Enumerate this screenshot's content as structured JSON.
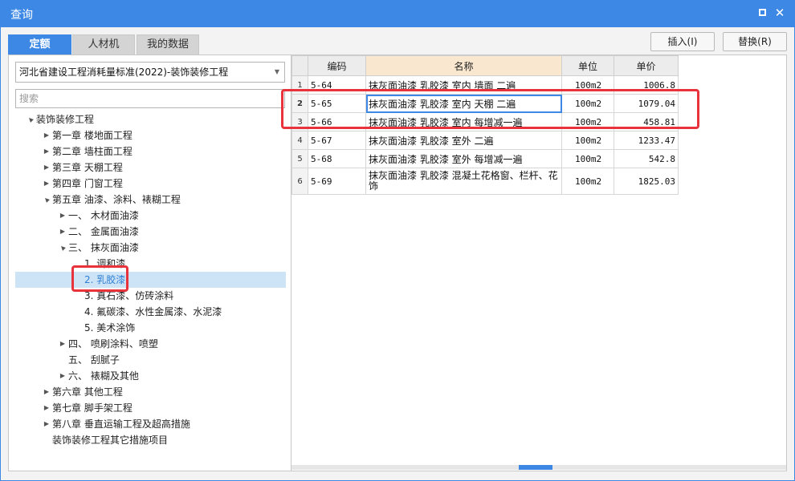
{
  "window": {
    "title": "查询"
  },
  "tabs": [
    {
      "label": "定额",
      "active": true
    },
    {
      "label": "人材机",
      "active": false
    },
    {
      "label": "我的数据",
      "active": false
    }
  ],
  "buttons": {
    "insert": "插入(I)",
    "replace": "替换(R)"
  },
  "library": {
    "selected": "河北省建设工程消耗量标准(2022)-装饰装修工程"
  },
  "search": {
    "placeholder": "搜索"
  },
  "tree": [
    {
      "label": "装饰装修工程",
      "level": 0,
      "toggle": "▲"
    },
    {
      "label": "第一章  楼地面工程",
      "level": 1,
      "toggle": "▶"
    },
    {
      "label": "第二章  墙柱面工程",
      "level": 1,
      "toggle": "▶"
    },
    {
      "label": "第三章  天棚工程",
      "level": 1,
      "toggle": "▶"
    },
    {
      "label": "第四章  门窗工程",
      "level": 1,
      "toggle": "▶"
    },
    {
      "label": "第五章  油漆、涂料、裱糊工程",
      "level": 1,
      "toggle": "▲"
    },
    {
      "label": "一、  木材面油漆",
      "level": 2,
      "toggle": "▶"
    },
    {
      "label": "二、  金属面油漆",
      "level": 2,
      "toggle": "▶"
    },
    {
      "label": "三、  抹灰面油漆",
      "level": 2,
      "toggle": "▲"
    },
    {
      "label": "1. 调和漆",
      "level": 3,
      "toggle": ""
    },
    {
      "label": "2. 乳胶漆",
      "level": 3,
      "toggle": "",
      "selected": true
    },
    {
      "label": "3. 真石漆、仿砖涂料",
      "level": 3,
      "toggle": ""
    },
    {
      "label": "4. 氟碳漆、水性金属漆、水泥漆",
      "level": 3,
      "toggle": ""
    },
    {
      "label": "5. 美术涂饰",
      "level": 3,
      "toggle": ""
    },
    {
      "label": "四、  喷刷涂料、喷塑",
      "level": 2,
      "toggle": "▶"
    },
    {
      "label": "五、  刮腻子",
      "level": 2,
      "toggle": ""
    },
    {
      "label": "六、  裱糊及其他",
      "level": 2,
      "toggle": "▶"
    },
    {
      "label": "第六章  其他工程",
      "level": 1,
      "toggle": "▶"
    },
    {
      "label": "第七章  脚手架工程",
      "level": 1,
      "toggle": "▶"
    },
    {
      "label": "第八章  垂直运输工程及超高措施",
      "level": 1,
      "toggle": "▶"
    },
    {
      "label": "装饰装修工程其它措施项目",
      "level": 1,
      "toggle": ""
    }
  ],
  "grid": {
    "headers": {
      "code": "编码",
      "name": "名称",
      "unit": "单位",
      "price": "单价"
    },
    "rows": [
      {
        "idx": "1",
        "code": "5-64",
        "name": "抹灰面油漆 乳胶漆 室内 墙面 二遍",
        "unit": "100m2",
        "price": "1006.8"
      },
      {
        "idx": "2",
        "code": "5-65",
        "name": "抹灰面油漆 乳胶漆 室内 天棚 二遍",
        "unit": "100m2",
        "price": "1079.04"
      },
      {
        "idx": "3",
        "code": "5-66",
        "name": "抹灰面油漆 乳胶漆 室内 每增减一遍",
        "unit": "100m2",
        "price": "458.81"
      },
      {
        "idx": "4",
        "code": "5-67",
        "name": "抹灰面油漆 乳胶漆 室外 二遍",
        "unit": "100m2",
        "price": "1233.47"
      },
      {
        "idx": "5",
        "code": "5-68",
        "name": "抹灰面油漆 乳胶漆 室外 每增减一遍",
        "unit": "100m2",
        "price": "542.8"
      },
      {
        "idx": "6",
        "code": "5-69",
        "name": "抹灰面油漆 乳胶漆 混凝土花格窗、栏杆、花饰",
        "unit": "100m2",
        "price": "1825.03"
      }
    ]
  },
  "colors": {
    "accent": "#3c88e4",
    "highlight": "#e8323c",
    "selection": "#cde4f7"
  },
  "icons": {
    "maximize": "maximize-icon",
    "close": "close-icon",
    "dropdown": "chevron-down-icon",
    "expanded": "triangle-expanded-icon",
    "collapsed": "triangle-collapsed-icon"
  }
}
